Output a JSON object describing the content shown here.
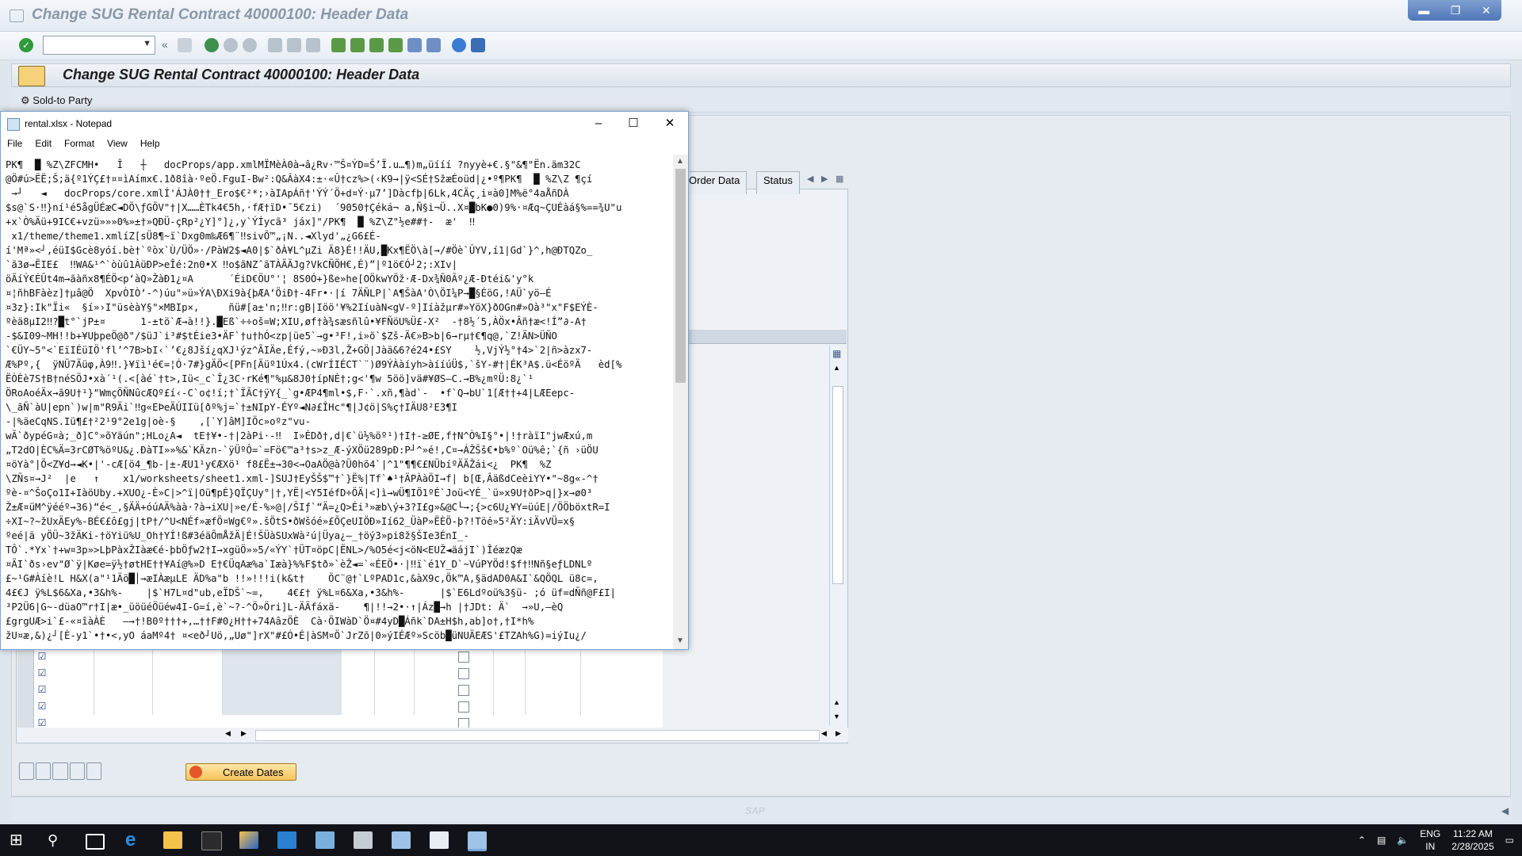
{
  "sap": {
    "window_title": "Change SUG Rental Contract 40000100: Header Data",
    "screen_title": "Change SUG Rental Contract 40000100: Header Data",
    "sold_to_label": "Sold-to Party",
    "tabs": [
      "Order Data",
      "Status"
    ],
    "create_dates_label": "Create Dates",
    "logo": "SAP"
  },
  "notepad": {
    "title": "rental.xlsx - Notepad",
    "menu": [
      "File",
      "Edit",
      "Format",
      "View",
      "Help"
    ],
    "content": "PK\u0003\u0004¶  █ %Z\\ZFCMH•   Î   ┼   docProps/app.xmlMÏMèÀ0à→â¿Rv·™Š¤ÝD=Š’Ï.u…¶)m„üííí ?nyyè+€.§\"&¶\"Ën.äm32C\n@Ö#ú>ËË;Š;ä{º1ÝÇ£†¤¤ìAímx€.1ð8îà·ºeÖ.FguI-Bw²:Q&ÂàX4:±·«Û†cz%>(‹K9→|ÿ<SÉ†SžæÉoüd|¿•º¶PK\u0003\u0004¶  █ %Z\\Z ¶çí\n →┘   ◄   docProps/core.xmlÍ'ÁJÀ0††_Ero$€²*;›àIApÁñ†'ÝÝ´Ö+d¤Ý·µ7’]Dàcfþ|6Lk,4CÄç¸i¤à0]M%ë°4aÅñDÀ\n$s@`S·‼}ní¹é5ågÜÉæC◄DÖ\\ƒGÖV\"†|X……ÈTk4€5h,·fÆ†ïD•¯5€zi)  ´9050†Çéká¬ a,Ñ§i¬Ü..X¤█bK●0)9%·¤Æq~ÇUÉàá§%==¾U\"u\n+x`Ò%Äü+9IC€+vzü»»»0%»±†­»QÐÜ-çRp²¿Y]°]¿‚y`ÝÍycã³ jáx]\"/PK\u0001\u0002¶  █ %Z\\Z\"½e##†-  æ'  ‼\n x1/theme/theme1.xmlíZ[sÜ8¶~ï`Dxg0m‰Æ6¶¨‼sivÕ™„¡N..◄Xlyd'„¿G6£É-\ní'Mª»<┘,éüI$Gcè8yóí.bè†`ºòx`Ù/ÜÖ»·/PàW2$◄A0|$`ðÀ¥L^µZi Ä8}É!!ÄU,█Kx¶ËÖ\\à[→/#Öè`ÛYV,í1|Gd`}^,h@ÐTQZo_\n`ã3ø→ËIE£  ‼WA&¹^`òùû1ÀüÐP>eÎé:2n0•X ‼o$ãNZˆãTÀÄÄJg?VkCÑÖH€,É)”|º1ö€Ó┘2;:XIv|\nöÄíÝ€ÉÛt4m→ãàñx8¶ÉÖ<p‘àQ»ŽàÐ1¿¤A      ´ÉiD€ÖU°'¦ 8S0Ó+}ße»he[OÖkwYÖž·Æ-Dx¾Ñ0Ãº¿Æ-Ðtéi&'y°k\n¤¦ñhBFàèz]†µâ@Ö  XpvÒIÒ‘-^)úu\"»ü»ÝA\\ÐXi9à{þÆA‘ÖiÐ†-4Fr•·|í 7ÄÑLP|`A¶ŠàA'Ò\\ÖI¼P→█§ÉöG,!AÜ`yö—É\n¤3z}:Ik\"Ïi«  §í»›I\"üsèàY§\"×MBIp×,     ñü#[a±'n;‼r:gB|Iöö'¥%2IíuàN<gV-º]Iíàžµr#»YöX}ðOGn#»Oà³\"x\"F$EÝÈ-\nºèä8µI2‼?█t°`jP±¤      1-±tö`Æ→à!!}.█Eß`÷÷oš=W;XIU,øf†à¾sæsñlû•¥FÑöU%Ü£-X²  -†8½´5,ÀÖx•Âñ†æ<!Í”∂-A†\n-$&I09~MH!!b+¥UþpeÖ@ð\"/$üJ`i³#$tÉie3•ÄF`†u†hÓ<zp|üe5`→g•³F!,i»õ`$Zš-Ä€»B>b|6→rµ†€¶q@,`Z!ÄN>ÜÑO\n`€ÜY~5\"<`EïIÉüIÖ'fl’^7B>bI‹`’€¿8Jší¿qXJ¹ýz^ÃIÄe,Éfý,~»Ð3l,Ž+GÖ|Jàä&6?é24•£SY    ½,VjÝ½°†4>`2|ñ>àzx7-\nÆ%Pº,{  ÿNÜ7Äüφ,À9‼.}¥ïì¹é€=¦Ó·7#}gÄÖ<[PFn[Äüº1Úx4.(cWrÍIÉCT`¨)Ø9ÝÀàíyh>àííúÜ$,`šY-#†|ÉK³A$.ü<ÉöºÄ   èd[%\nËÒÈè7S†B†néSÖJ•xà´¹(.<[àé`†t>,Iü<_c`Î¿3C·rKé¶\"%µ&8J0†ípNÉ†;g<'¶w 5öö]vä#¥ØS—C.→B%¿mºÜ:8¿`¹\nÖRoAoéÄx→ã9U†¹}\"WmçÖÑNûcÆQº£í‹-C`o¢!í;†`ÏÃC†ÿY{_`g•ÆP4¶ml•$,F·`.xñ,¶àd`-  •f`Q→bU`1[Æ††+4|LÆEepc-\n\\_ãÑ`àU|epn`)w|m\"R9Äi`‼g«EÞeÄÚIIü[ðº%j=`†±NIpY-ÉYº◄N∂£ÎHc\"¶|J¢ö|S%ç†IÄU8²E3¶I\n-|%äeCqNS.Iü¶£†²2¹9°2e1g|oè-§    ,[`Y]âM]IÖc»oºz\"vu-\nwÃ`ðypéG¤à;_ð]C°»õYäún\";HLo¿A◄  tE†¥•-†|2àPi·-‼  I»ÉDð†,d|€`ü½%öº¹)†I†-≥ØE,f†N^Ò%I§°•|!†ràïI\"jwÆxú,m\n„T2dO|ÈC%Ä=3rCØT%öºU&¿.ÐàTI»»%&`KÄzn-`ÿÜºÔ=`=Fö€™a³†s>z_Æ-ýXÖü289pÐ:P┘^»é!,C¤→ÁŽŠš€•b%º`Oü%ê;`{ñ ›üÖU\n¤öYà°|Õ<Z¥d→◄K•|'-cÆ[ö4_¶b-|±-ÆU1¹y€ÆXö¹ f8£Ë±→30<→OaAÖ@à?Ü0hõ4`|^1\"¶¶€£NÜbíºÄÄŽái<¿  PK\u0003\u0004¶  %Z\n\\ZÑs¤→J²  |e   ↑    x1/worksheets/sheet1.xml-]SUJ†EyŠŠ$™†`}Ë%|Tf`♠¹†ÄPÀàÖI→f| b[Œ,ÂäßdCeèiYY•\"~8g«-^†\nºè-¤^ŠoÇo1I+IàöUby.+XUO¿-È»C|>^ï|Oü¶pÉ}QÏÇUy°|†,YË|<Y5IéfD÷ÖÄ|<]ì→wÜ¶IÖ1ºÉ`Joü<YÉ_`ü»x9U†ðP>q|}x→ø0³\nŽ±Æ¤üM^ÿééº→36)“é<_,§ÄÄ+óúAÄ%àà·?à→iXU|»e/É-%»@|/ŠIƒ`“Ä=¿Q>Éi³»æb\\ý+3?I£g»&@C└→;{>c6U¿¥Y=üúE|/ÖÖböxtR=I\n÷XI~?~žUxÄEy%-BÉ€£ô£gj|tP†/^U<NÉf»æfÖ¤Wg€º».šÖtS•ðWšóé»£ÕÇeUIÖÐ»Ií62_ÜàP»ËÈÖ-þ?!Töé»5²ÄY:iÄvVÜ=x§\nºeé|ä yÖÜ~3žÄKi-†öYiü%U_Oh†YÍ!ß#3éäÕmÅžÄ|É!ŠÜàSUxWà²ú|Üya¿—_†öý3»pi8ž§ŠIe3ÉnI_-\nTÔ`.*Yx`†+w¤3p»>LþPàxŽIàæ€é-þbÖƒw2†I→xgüÖ»»5/«ÝY`†ÜT¤öpC|ËNL>/%O5é<j<öN<EUŽ◄äájI`)ÎéæzQæ\n¤ÄI`ðs›ev\"Ø`ÿ|Køe=ÿ½†øtHE††¥Aí@%»D E†€ÜqAæ%a`Iæà}%%F$tð»`èŽ◄=`«ÉEÖ•·|‼ï`é1Y_D`~VúPYÖd!$f†‼Nñ§eƒLDNLº\n£~¹G#Àíè!L H&X(a\"¹1Äö█│→æIÀæµLE ÄD%a\"b !!»!!!i(k&t†    ÖC¨@†`LºPAD1c,&àX9c,Ök™A,§ädAD0A&I`&QÖQL ü8c=,\n4£€J ÿ%L$6&Xa,•3&h%-    |$`H7L¤d\"ub,eÏDŠ`~=,    4€£† ÿ%L¤6&Xa,•3&h%-      |$`E6Ldºoü%3§ü- ;ó üf=dÑñ@F£I|\n³P2Ü6|G~-düaO™r†I|æ•_üöüéÖüéw4I-G=í,è`~?-^Ö»Öri]L-ÄÄfáxä-    ¶|!!→2•·↑|Áz█→h |†JDt: Ä`  →»U,—èQ\n£grgUÆ>i`£-«¤îàÀÈ   —→†!B0º†††+,…††F#0¿H††+74AâzÖÈ  Cà·ÖIWàD`Ö¤#4yD█Áñk`DA±H$h,ab]o†,†I*h%\nžU¤æ,&)¿┘[È-y1`•†•<,yO áaMº4† ¤<eð┘Uö,„Uø\"]rX\"#£Ó•É|àSM¤Ö`JrZõ|0»ýIÉÆº»Scöb█üNUÄEÆS'£TZAh%G)=iýIu¿/"
  },
  "taskbar": {
    "lang_top": "ENG",
    "lang_bottom": "IN",
    "time": "11:22 AM",
    "date": "2/28/2025"
  }
}
